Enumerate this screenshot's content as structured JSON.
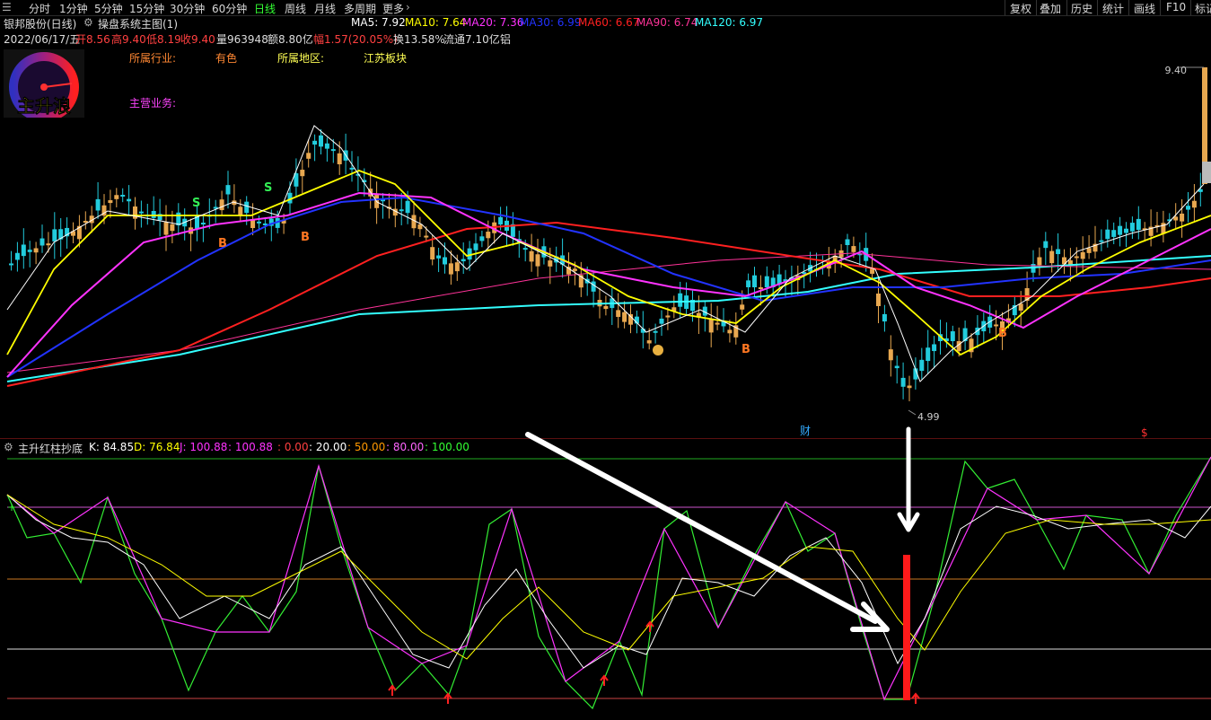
{
  "toolbar": {
    "periods": [
      "分时",
      "1分钟",
      "5分钟",
      "15分钟",
      "30分钟",
      "60分钟",
      "日线",
      "周线",
      "月线",
      "多周期",
      "更多"
    ],
    "active": "日线",
    "right": [
      "复权",
      "叠加",
      "历史",
      "统计",
      "画线",
      "F10",
      "标记"
    ]
  },
  "header": {
    "stock": "银邦股份(日线)",
    "system": "操盘系统主图(1)",
    "ma": [
      {
        "label": "MA5: 7.92",
        "color": "#ffffff"
      },
      {
        "label": "MA10: 7.64",
        "color": "#ffff00"
      },
      {
        "label": "MA20: 7.36",
        "color": "#ff33ff"
      },
      {
        "label": "MA30: 6.99",
        "color": "#2233ff"
      },
      {
        "label": "MA60: 6.67",
        "color": "#ff2020"
      },
      {
        "label": "MA90: 6.74",
        "color": "#ff3399"
      },
      {
        "label": "MA120: 6.97",
        "color": "#33ffff"
      }
    ]
  },
  "quote": {
    "date": "2022/06/17/五",
    "open_label": "开",
    "open": "8.56",
    "high_label": "高",
    "high": "9.40",
    "low_label": "低",
    "low": "8.19",
    "close_label": "收",
    "close": "9.40",
    "vol_label": "量",
    "vol": "963948",
    "amt_label": "额",
    "amt": "8.80亿",
    "chg_label": "幅",
    "chg": "1.57(20.05%)",
    "turn_label": "换",
    "turn": "13.58%",
    "float_label": "流通",
    "float": "7.10亿",
    "tag": "铝"
  },
  "info": {
    "industry_label": "所属行业:",
    "industry": "有色",
    "region_label": "所属地区:",
    "region": "江苏板块",
    "business_label": "主营业务:"
  },
  "logo_text": "主升浪",
  "price_labels": {
    "high": "9.40",
    "low": "4.99"
  },
  "markers": {
    "cai": "财",
    "dollar": "$"
  },
  "indicator": {
    "name": "主升红柱抄底",
    "values": [
      {
        "label": "K: 84.85",
        "color": "#ffffff"
      },
      {
        "label": "D: 76.84",
        "color": "#ffff00"
      },
      {
        "label": "J: 100.88",
        "color": "#ff33ff"
      },
      {
        "label": ": 100.88",
        "color": "#ff33ff"
      },
      {
        "label": ": 0.00",
        "color": "#ff4040"
      },
      {
        "label": ": 20.00",
        "color": "#ffffff"
      },
      {
        "label": ": 50.00",
        "color": "#ff9900"
      },
      {
        "label": ": 80.00",
        "color": "#ff66ff"
      },
      {
        "label": ": 100.00",
        "color": "#33ff33"
      }
    ]
  },
  "colors": {
    "up": "#e8a850",
    "down": "#22ccdd",
    "ma5": "#ffffff",
    "ma10": "#ffff00",
    "ma20": "#ff33ff",
    "ma30": "#2233ff",
    "ma60": "#ff2020",
    "ma90": "#ff3399",
    "ma120": "#33ffff"
  }
}
